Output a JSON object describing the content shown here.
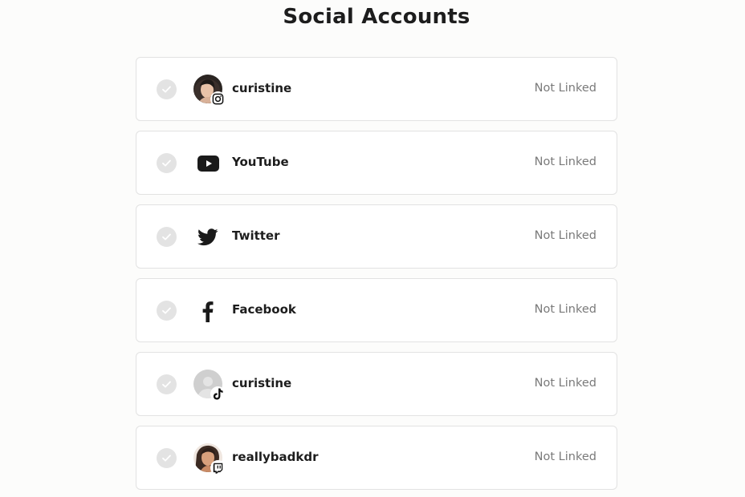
{
  "page": {
    "title": "Social Accounts"
  },
  "accounts": [
    {
      "platform": "Instagram",
      "display_name": "curistine",
      "status": "Not Linked",
      "icon": "instagram-icon",
      "avatar": "photo"
    },
    {
      "platform": "YouTube",
      "display_name": "YouTube",
      "status": "Not Linked",
      "icon": "youtube-icon",
      "avatar": "none"
    },
    {
      "platform": "Twitter",
      "display_name": "Twitter",
      "status": "Not Linked",
      "icon": "twitter-icon",
      "avatar": "none"
    },
    {
      "platform": "Facebook",
      "display_name": "Facebook",
      "status": "Not Linked",
      "icon": "facebook-icon",
      "avatar": "none"
    },
    {
      "platform": "TikTok",
      "display_name": "curistine",
      "status": "Not Linked",
      "icon": "tiktok-icon",
      "avatar": "placeholder"
    },
    {
      "platform": "Twitch",
      "display_name": "reallybadkdr",
      "status": "Not Linked",
      "icon": "twitch-icon",
      "avatar": "photo"
    }
  ],
  "colors": {
    "text": "#1d1d1d",
    "status_text": "#7a7a7a",
    "checkbox": "#e3e3e3",
    "border": "#e2e2e2",
    "background": "#fcfcfb"
  }
}
